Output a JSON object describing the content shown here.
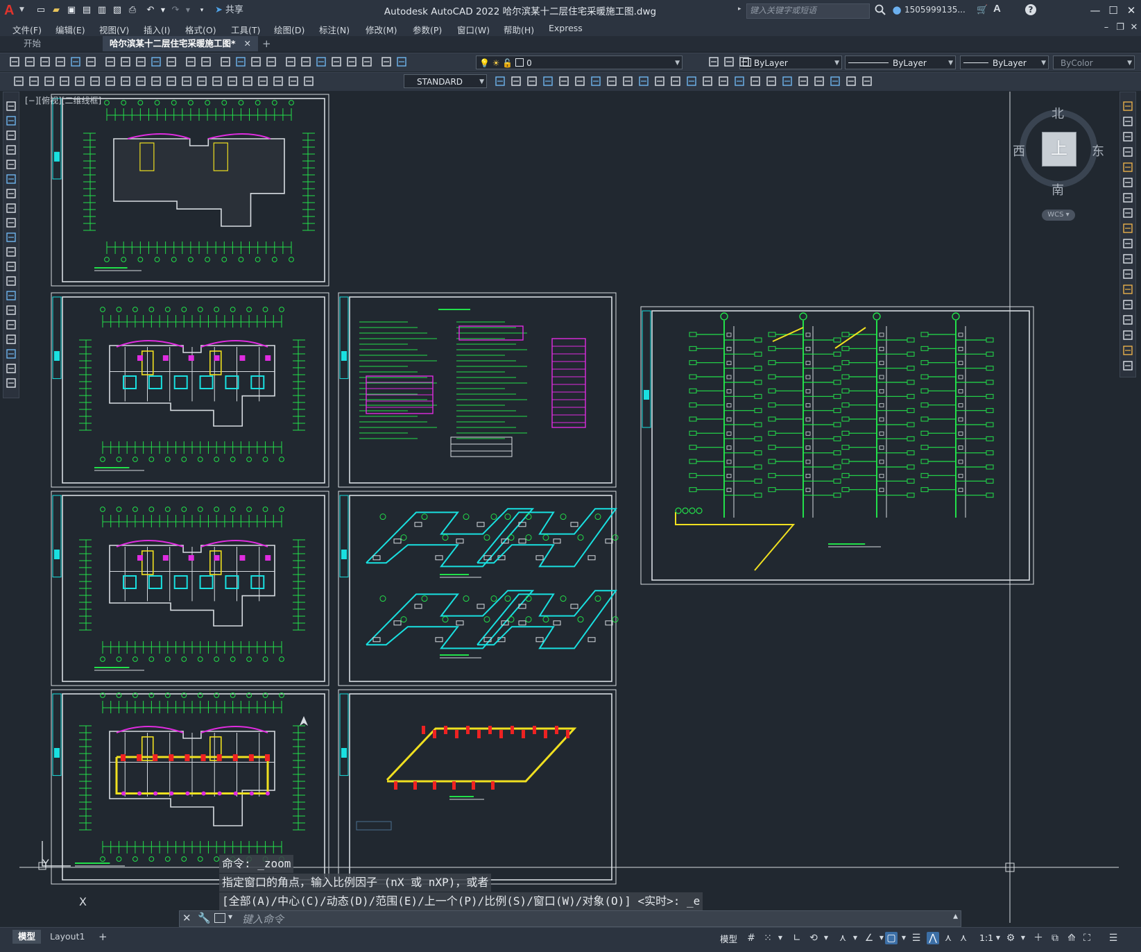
{
  "app": {
    "title": "Autodesk AutoCAD 2022    哈尔滨某十二层住宅采暖施工图.dwg",
    "logo": "A",
    "share_label": "共享"
  },
  "search": {
    "placeholder": "键入关键字或短语"
  },
  "user": {
    "name": "1505999135..."
  },
  "menu": [
    "文件(F)",
    "编辑(E)",
    "视图(V)",
    "插入(I)",
    "格式(O)",
    "工具(T)",
    "绘图(D)",
    "标注(N)",
    "修改(M)",
    "参数(P)",
    "窗口(W)",
    "帮助(H)",
    "Express"
  ],
  "tabs": {
    "start": "开始",
    "active": "哈尔滨某十二层住宅采暖施工图*",
    "close": "✕",
    "add": "+"
  },
  "toolbar": {
    "layer_value": "0",
    "color_value": "ByLayer",
    "linetype_value": "ByLayer",
    "lineweight_value": "ByLayer",
    "plotstyle_value": "ByColor",
    "textstyle_value": "STANDARD"
  },
  "viewport_label": "[−][俯视][二维线框]",
  "viewcube": {
    "north": "北",
    "south": "南",
    "east": "东",
    "west": "西",
    "face": "上",
    "wcs": "WCS"
  },
  "ucs": {
    "x": "X",
    "y": "Y"
  },
  "command": {
    "history": [
      "命令: _zoom",
      "指定窗口的角点，输入比例因子 (nX 或 nXP)，或者",
      "[全部(A)/中心(C)/动态(D)/范围(E)/上一个(P)/比例(S)/窗口(W)/对象(O)] <实时>: _e"
    ],
    "placeholder": "键入命令"
  },
  "layout_tabs": [
    "模型",
    "Layout1",
    "+"
  ],
  "status": {
    "model": "模型",
    "scale": "1:1"
  },
  "colors": {
    "green": "#22e04a",
    "cyan": "#19e0e0",
    "magenta": "#e02ce0",
    "yellow": "#f0e020",
    "red": "#ee2222",
    "white_line": "#d7dce1",
    "background": "#212830"
  }
}
